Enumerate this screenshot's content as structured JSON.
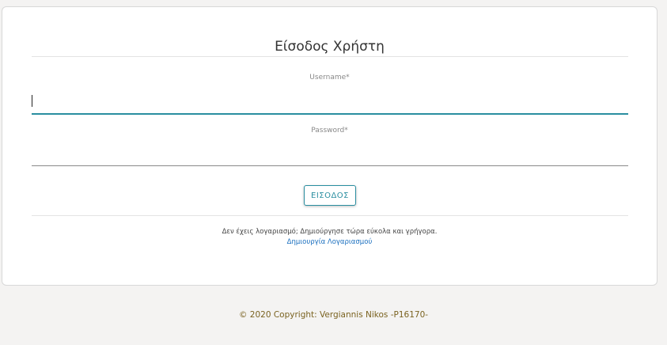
{
  "login": {
    "title": "Είσοδος Χρήστη",
    "username_label": "Username*",
    "username_value": "",
    "password_label": "Password*",
    "password_value": "",
    "submit_label": "ΕΙΣΟΔΟΣ",
    "no_account_text": "Δεν έχεις λογαριασμό; Δημιούργησε τώρα εύκολα και γρήγορα.",
    "create_account_link": "Δημιουργία Λογαριασμού"
  },
  "footer": {
    "copyright": "© 2020 Copyright: Vergiannis Nikos -P16170-"
  },
  "colors": {
    "accent": "#2a8ea0",
    "link": "#1a6fbf",
    "footer_text": "#7a6220",
    "page_background": "#f4f3f2"
  }
}
